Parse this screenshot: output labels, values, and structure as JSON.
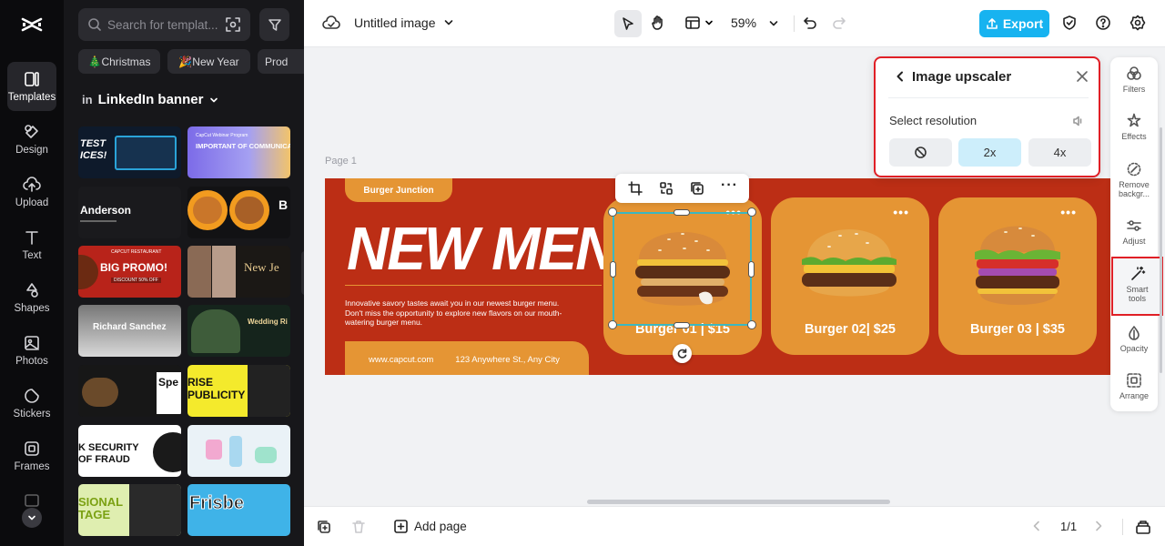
{
  "rail": {
    "items": [
      {
        "label": "Templates"
      },
      {
        "label": "Design"
      },
      {
        "label": "Upload"
      },
      {
        "label": "Text"
      },
      {
        "label": "Shapes"
      },
      {
        "label": "Photos"
      },
      {
        "label": "Stickers"
      },
      {
        "label": "Frames"
      }
    ]
  },
  "panel": {
    "search_placeholder": "Search for templat...",
    "chips": [
      "🎄Christmas",
      "🎉New Year",
      "Prod"
    ],
    "category": "LinkedIn banner",
    "thumbs": {
      "t1": "TEST ICES!",
      "t2_top": "CapCut Webinar Program",
      "t2_main": "IMPORTANT OF COMMUNICATION",
      "t3": "Anderson",
      "t5_top": "CAPCUT RESTAURANT",
      "t5_main": "BIG PROMO!",
      "t5_sub": "DISCOUNT 50% OFF",
      "t6": "New Je",
      "t7": "Richard Sanchez",
      "t8": "Wedding Ri",
      "t9": "Spe",
      "t10": "RISE PUBLICITY",
      "t11": "K SECURITY OF FRAUD",
      "t13": "SIONAL TAGE",
      "t14": "Frisbe"
    }
  },
  "topbar": {
    "title": "Untitled image",
    "zoom": "59%",
    "export_label": "Export"
  },
  "canvas": {
    "page_label": "Page 1"
  },
  "banner": {
    "brand_tag": "Burger Junction",
    "headline": "NEW MENU",
    "description": "Innovative savory tastes await you in our newest burger menu. Don't miss the opportunity to explore new flavors on our mouth-watering burger menu.",
    "website": "www.capcut.com",
    "address": "123 Anywhere St., Any City",
    "cards": [
      {
        "label": "Burger 01 | $15"
      },
      {
        "label": "Burger 02| $25"
      },
      {
        "label": "Burger 03 | $35"
      }
    ],
    "more_icon_text": "•••"
  },
  "upscaler": {
    "title": "Image upscaler",
    "section_label": "Select resolution",
    "options": [
      "",
      "2x",
      "4x"
    ],
    "selected": "2x"
  },
  "tools": {
    "items": [
      {
        "label": "Filters"
      },
      {
        "label": "Effects"
      },
      {
        "label": "Remove backgr..."
      },
      {
        "label": "Adjust"
      },
      {
        "label": "Smart tools"
      },
      {
        "label": "Opacity"
      },
      {
        "label": "Arrange"
      }
    ]
  },
  "bottombar": {
    "add_page": "Add page",
    "page_counter": "1/1"
  },
  "colors": {
    "banner_red": "#bc2e15",
    "card_orange": "#e59534",
    "export_blue": "#17b3f0",
    "highlight_red": "#e01f26",
    "selected_option": "#cdeefb"
  }
}
